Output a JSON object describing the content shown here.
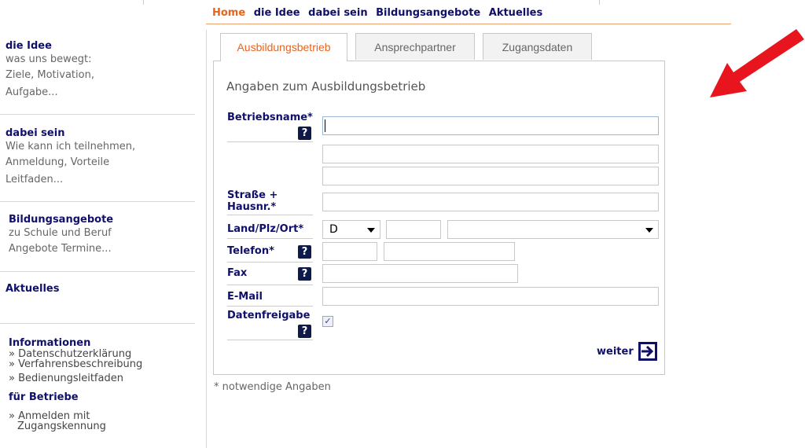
{
  "topnav": {
    "home": "Home",
    "items": [
      "die Idee",
      "dabei sein",
      "Bildungsangebote",
      "Aktuelles"
    ]
  },
  "sidebar": {
    "idee": {
      "title": "die Idee",
      "lines": [
        "was uns bewegt:",
        "Ziele, Motivation,",
        "Aufgabe..."
      ]
    },
    "dabei": {
      "title": "dabei sein",
      "lines": [
        "Wie kann ich teilnehmen,",
        "Anmeldung, Vorteile",
        "Leitfaden..."
      ]
    },
    "bildung": {
      "title": "Bildungsangebote",
      "lines": [
        "zu Schule und Beruf",
        "Angebote Termine..."
      ]
    },
    "aktuelles": {
      "title": "Aktuelles"
    },
    "info": {
      "title": "Informationen",
      "links": [
        "» Datenschutzerklärung",
        "» Verfahrensbeschreibung",
        "» Bedienungsleitfaden"
      ]
    },
    "betriebe": {
      "title": "für Betriebe",
      "link_line1": "» Anmelden mit",
      "link_line2": "Zugangskennung"
    }
  },
  "tabs": [
    "Ausbildungsbetrieb",
    "Ansprechpartner",
    "Zugangsdaten"
  ],
  "form": {
    "title": "Angaben zum Ausbildungsbetrieb",
    "labels": {
      "betriebsname": "Betriebsname*",
      "strasse_1": "Straße +",
      "strasse_2": "Hausnr.*",
      "land": "Land/Plz/Ort*",
      "telefon": "Telefon*",
      "fax": "Fax",
      "email": "E-Mail",
      "datenfreigabe": "Datenfreigabe"
    },
    "help_symbol": "?",
    "country_value": "D",
    "checkbox_checked": true,
    "checkbox_mark": "✓",
    "weiter": "weiter"
  },
  "footnote": "* notwendige Angaben",
  "colors": {
    "accent_orange": "#e8641e",
    "navy": "#10106a",
    "help_bg": "#0e1a4a",
    "arrow_red": "#e8141e"
  }
}
